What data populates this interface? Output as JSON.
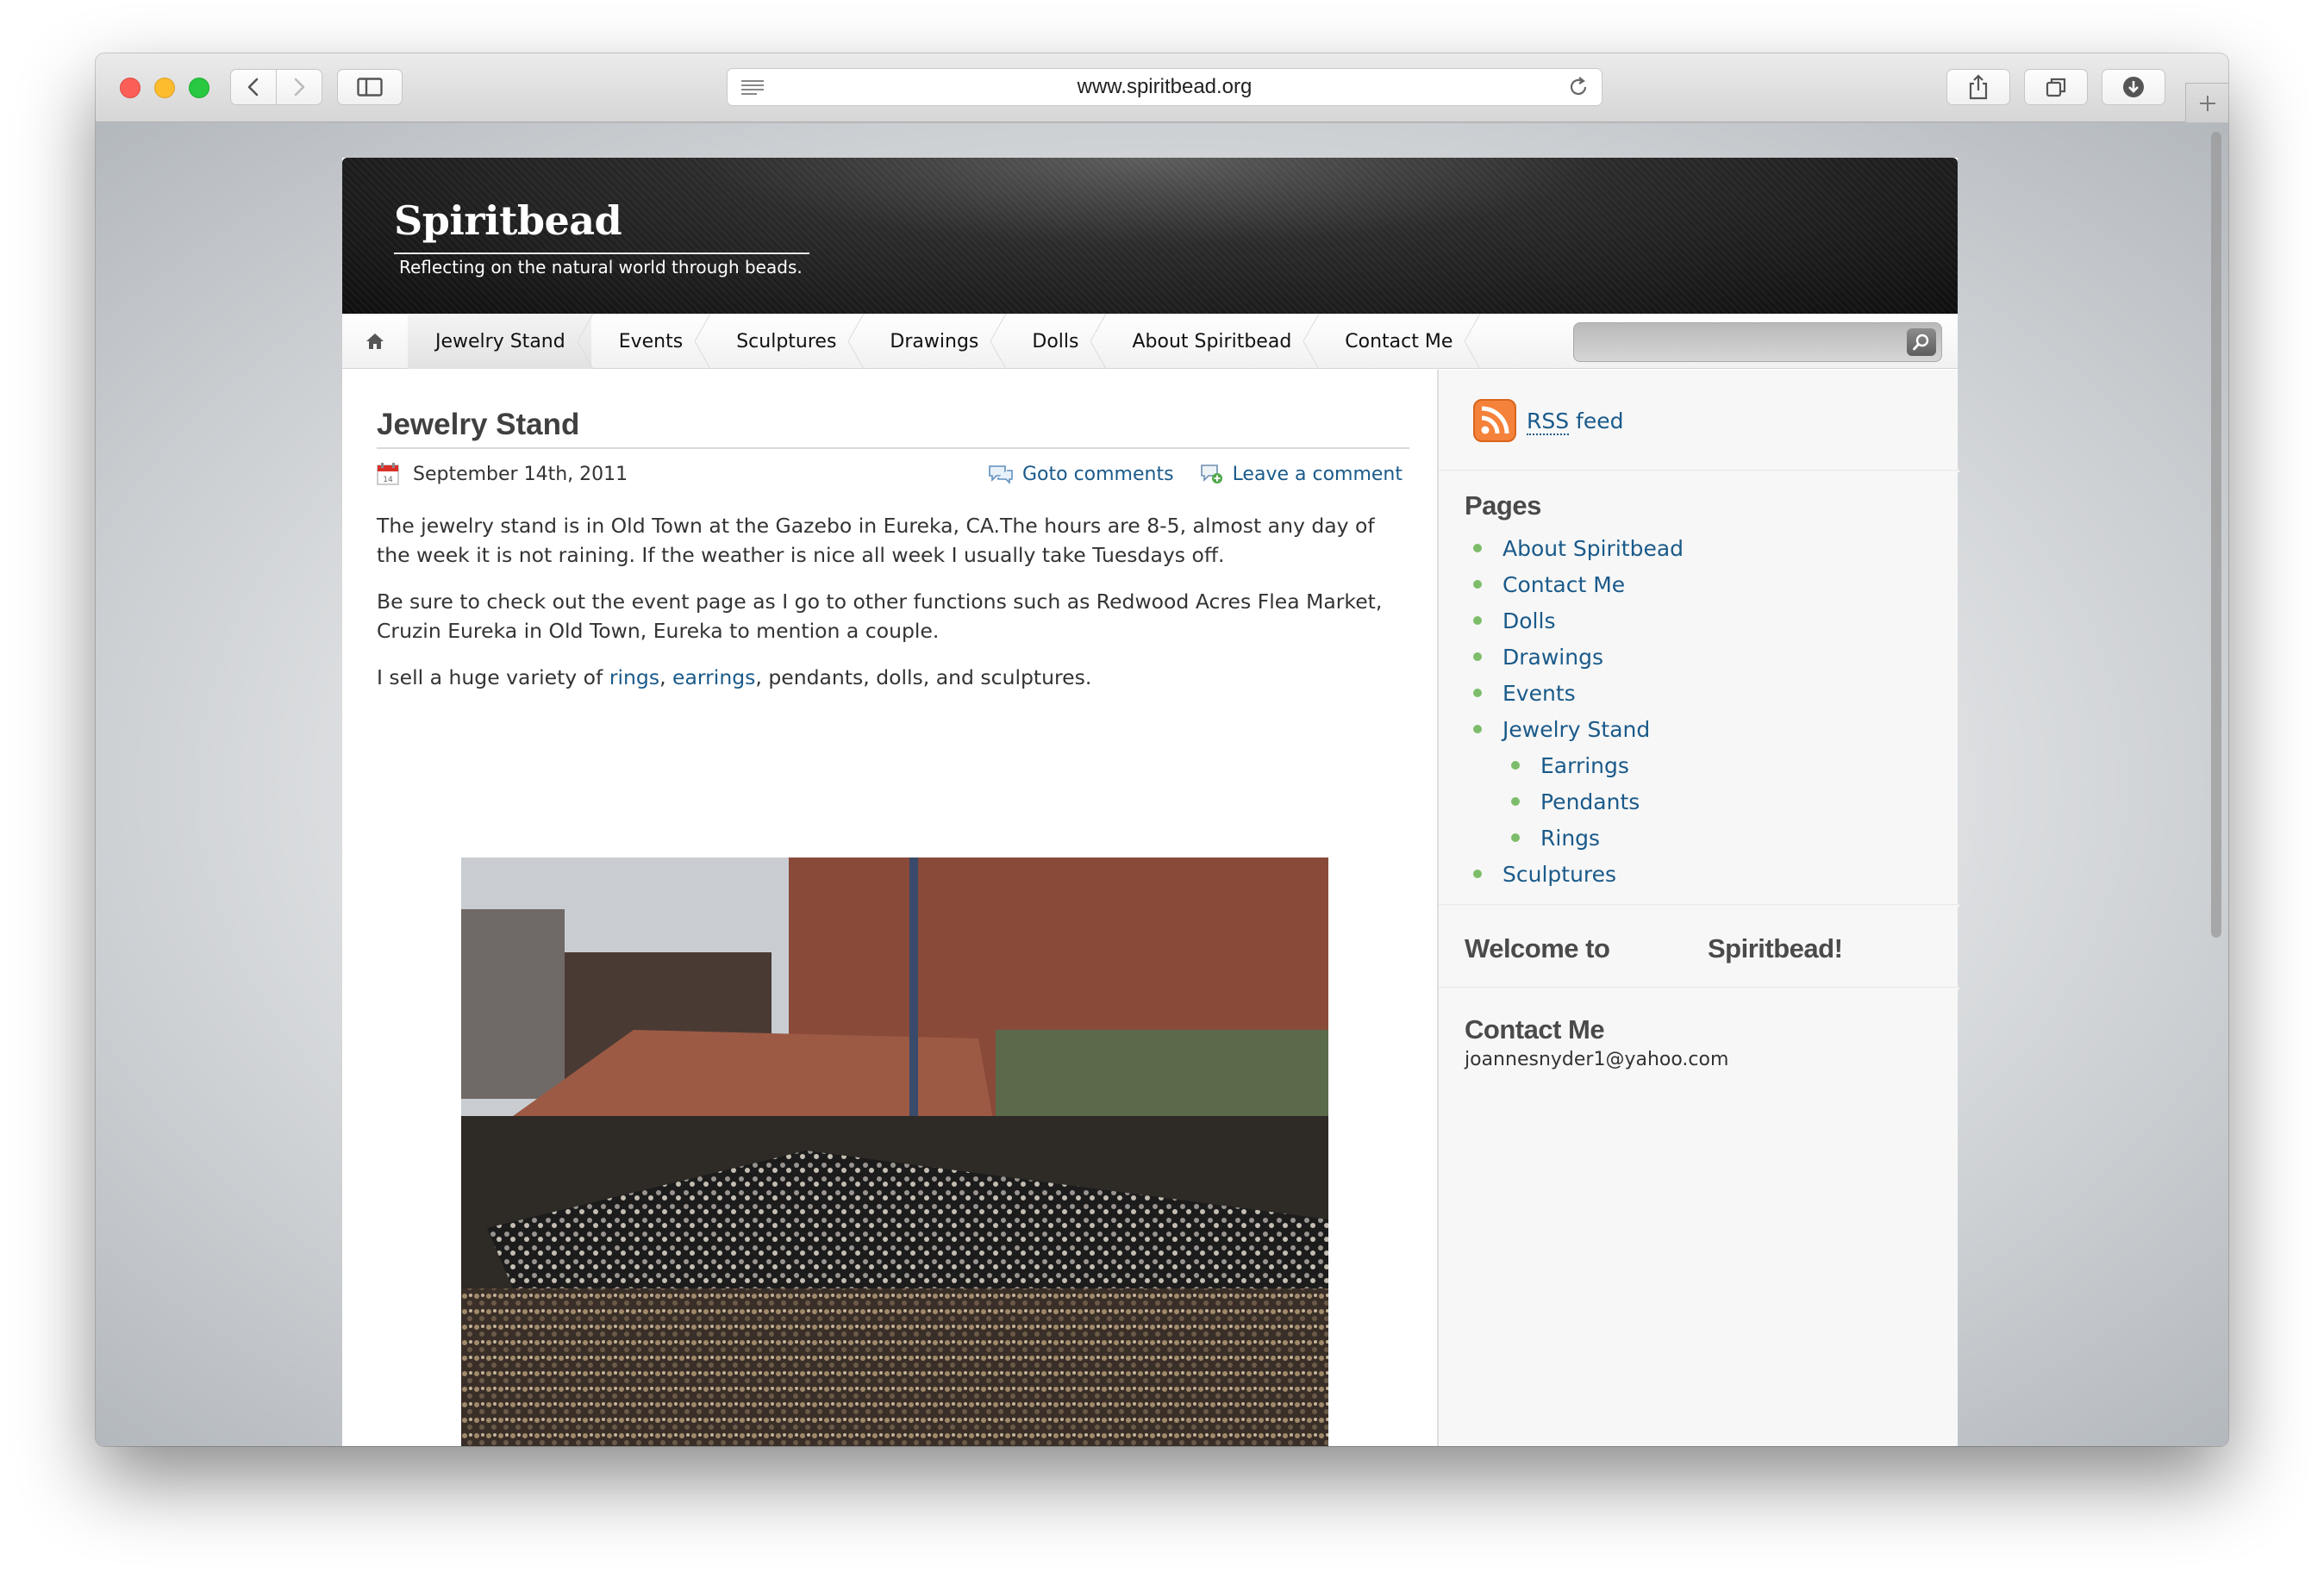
{
  "browser": {
    "url": "www.spiritbead.org",
    "nav_buttons": {
      "back": "chevron-left-icon",
      "forward": "chevron-right-icon",
      "sidebar": "sidebar-icon"
    },
    "toolbar_icons": [
      "reader-icon",
      "reload-icon",
      "share-icon",
      "tabs-icon",
      "download-icon",
      "plus-icon"
    ]
  },
  "site": {
    "title": "Spiritbead",
    "description": "Reflecting on the natural world through beads."
  },
  "nav": {
    "home_icon": "home-icon",
    "items": [
      {
        "label": "Jewelry Stand",
        "active": true
      },
      {
        "label": "Events"
      },
      {
        "label": "Sculptures"
      },
      {
        "label": "Drawings"
      },
      {
        "label": "Dolls"
      },
      {
        "label": "About Spiritbead"
      },
      {
        "label": "Contact Me"
      }
    ],
    "search": {
      "value": "",
      "button_icon": "search-icon"
    }
  },
  "post": {
    "title": "Jewelry Stand",
    "date": "September 14th, 2011",
    "goto_comments": "Goto comments",
    "leave_comment": "Leave a comment",
    "p1": "The jewelry stand is in Old Town at the Gazebo in Eureka, CA.The hours are 8-5, almost any day of the week it is not raining.  If the weather is nice all week I usually take Tuesdays off.",
    "p2": "Be sure to check out the event page as I go to other functions  such as Redwood Acres Flea Market, Cruzin Eureka in Old Town, Eureka to mention a couple.",
    "p3_before": "I sell a huge variety of ",
    "p3_link1": "rings",
    "p3_sep": ", ",
    "p3_link2": "earrings",
    "p3_after": ", pendants, dolls, and sculptures."
  },
  "sidebar": {
    "rss_abbr": "RSS",
    "rss_rest": " feed",
    "pages_title": "Pages",
    "pages": [
      {
        "label": "About Spiritbead",
        "level": 0
      },
      {
        "label": "Contact Me",
        "level": 0
      },
      {
        "label": "Dolls",
        "level": 0
      },
      {
        "label": "Drawings",
        "level": 0
      },
      {
        "label": "Events",
        "level": 0
      },
      {
        "label": "Jewelry Stand",
        "level": 0
      },
      {
        "label": "Earrings",
        "level": 1
      },
      {
        "label": "Pendants",
        "level": 1
      },
      {
        "label": "Rings",
        "level": 1
      },
      {
        "label": "Sculptures",
        "level": 0
      }
    ],
    "welcome_a": "Welcome to",
    "welcome_b": "Spiritbead!",
    "contact_title": "Contact Me",
    "contact_email": "joannesnyder1@yahoo.com"
  },
  "colors": {
    "link": "#1a5a8a",
    "bullet": "#7dbd6a",
    "rss": "#f5823a"
  }
}
